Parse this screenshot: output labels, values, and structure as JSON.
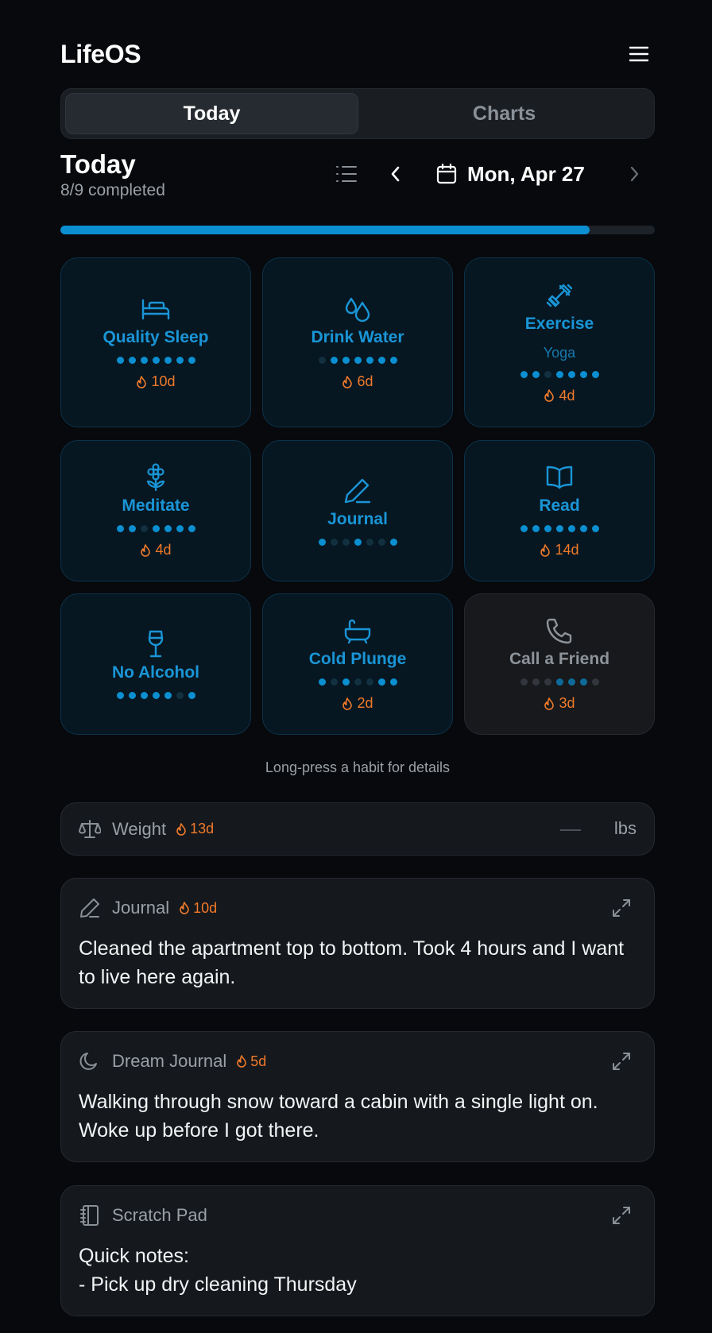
{
  "app": {
    "title": "LifeOS"
  },
  "tabs": [
    {
      "label": "Today",
      "active": true
    },
    {
      "label": "Charts",
      "active": false
    }
  ],
  "today": {
    "title": "Today",
    "completed_text": "8/9 completed",
    "date": "Mon, Apr 27",
    "progress": 0.89
  },
  "colors": {
    "accent": "#0b8fd0",
    "streak": "#f07a2a",
    "background": "#07090d"
  },
  "habits": [
    {
      "name": "Quality Sleep",
      "icon": "bed-icon",
      "sub": "",
      "dots": [
        1,
        1,
        1,
        1,
        1,
        1,
        1
      ],
      "streak": "10d",
      "done": true
    },
    {
      "name": "Drink Water",
      "icon": "droplets-icon",
      "sub": "",
      "dots": [
        0,
        1,
        1,
        1,
        1,
        1,
        1
      ],
      "streak": "6d",
      "done": true
    },
    {
      "name": "Exercise",
      "icon": "dumbbell-icon",
      "sub": "Yoga",
      "dots": [
        1,
        1,
        0,
        1,
        1,
        1,
        1
      ],
      "streak": "4d",
      "done": true
    },
    {
      "name": "Meditate",
      "icon": "flower-icon",
      "sub": "",
      "dots": [
        1,
        1,
        0,
        1,
        1,
        1,
        1
      ],
      "streak": "4d",
      "done": true
    },
    {
      "name": "Journal",
      "icon": "pen-icon",
      "sub": "",
      "dots": [
        1,
        0,
        0,
        1,
        0,
        0,
        1
      ],
      "streak": "",
      "done": true
    },
    {
      "name": "Read",
      "icon": "book-open-icon",
      "sub": "",
      "dots": [
        1,
        1,
        1,
        1,
        1,
        1,
        1
      ],
      "streak": "14d",
      "done": true
    },
    {
      "name": "No Alcohol",
      "icon": "wine-icon",
      "sub": "",
      "dots": [
        1,
        1,
        1,
        1,
        1,
        0,
        1
      ],
      "streak": "",
      "done": true
    },
    {
      "name": "Cold Plunge",
      "icon": "bath-icon",
      "sub": "",
      "dots": [
        1,
        0,
        1,
        0,
        0,
        1,
        1
      ],
      "streak": "2d",
      "done": true
    },
    {
      "name": "Call a Friend",
      "icon": "phone-icon",
      "sub": "",
      "dots": [
        0,
        0,
        0,
        1,
        1,
        1,
        0
      ],
      "streak": "3d",
      "done": false
    }
  ],
  "hint": "Long-press a habit for details",
  "weight": {
    "label": "Weight",
    "streak": "13d",
    "value": "—",
    "unit": "lbs"
  },
  "journal": {
    "label": "Journal",
    "streak": "10d",
    "text": "Cleaned the apartment top to bottom. Took 4 hours and I want to live here again."
  },
  "dream": {
    "label": "Dream Journal",
    "streak": "5d",
    "text": "Walking through snow toward a cabin with a single light on. Woke up before I got there."
  },
  "scratch": {
    "label": "Scratch Pad",
    "text": "Quick notes:\n- Pick up dry cleaning Thursday"
  }
}
